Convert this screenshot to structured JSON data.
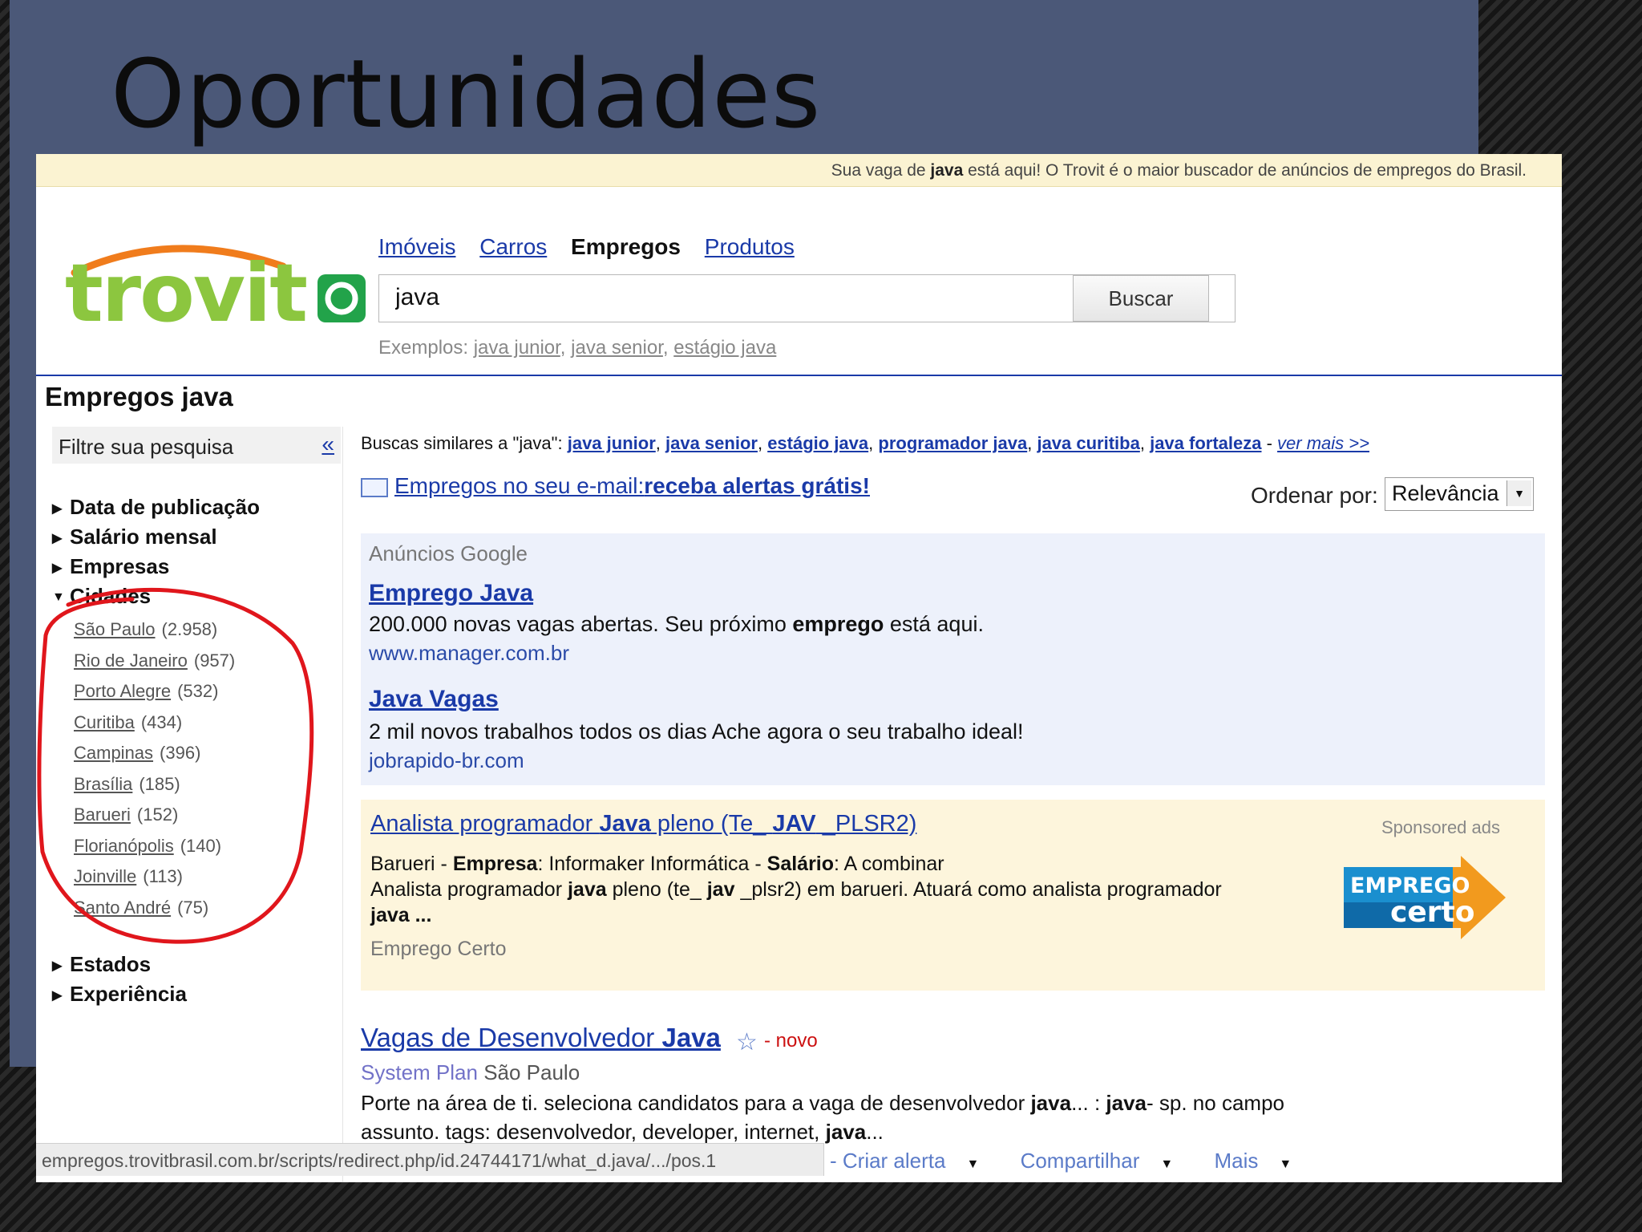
{
  "slide": {
    "title": "Oportunidades"
  },
  "promo": {
    "pre": "Sua vaga de ",
    "bold": "java",
    "post": " está aqui! O Trovit é o maior buscador de anúncios de empregos do Brasil."
  },
  "logo": {
    "text": "trovit"
  },
  "nav": [
    {
      "label": "Imóveis",
      "active": false
    },
    {
      "label": "Carros",
      "active": false
    },
    {
      "label": "Empregos",
      "active": true
    },
    {
      "label": "Produtos",
      "active": false
    }
  ],
  "search": {
    "value": "java",
    "button": "Buscar"
  },
  "examples": {
    "prefix": "Exemplos:",
    "items": [
      "java junior",
      "java senior",
      "estágio java"
    ]
  },
  "page_title": "Empregos java",
  "sidebar": {
    "filter_label": "Filtre sua pesquisa",
    "collapse_label": "«",
    "facets": [
      "Data de publicação",
      "Salário mensal",
      "Empresas",
      "Cidades",
      "Estados",
      "Experiência"
    ],
    "cities": [
      {
        "name": "São Paulo",
        "count": "(2.958)"
      },
      {
        "name": "Rio de Janeiro",
        "count": "(957)"
      },
      {
        "name": "Porto Alegre",
        "count": "(532)"
      },
      {
        "name": "Curitiba",
        "count": "(434)"
      },
      {
        "name": "Campinas",
        "count": "(396)"
      },
      {
        "name": "Brasília",
        "count": "(185)"
      },
      {
        "name": "Barueri",
        "count": "(152)"
      },
      {
        "name": "Florianópolis",
        "count": "(140)"
      },
      {
        "name": "Joinville",
        "count": "(113)"
      },
      {
        "name": "Santo André",
        "count": "(75)"
      }
    ]
  },
  "similar": {
    "prefix": "Buscas similares a \"java\":",
    "items": [
      "java junior",
      "java senior",
      "estágio java",
      "programador java",
      "java curitiba",
      "java fortaleza"
    ],
    "more": "ver mais >>"
  },
  "email_alert": {
    "text": "Empregos no seu e-mail:",
    "bold": "receba alertas grátis!"
  },
  "order": {
    "label": "Ordenar por:",
    "value": "Relevância"
  },
  "google_ads": {
    "label": "Anúncios Google",
    "ads": [
      {
        "title": "Emprego Java",
        "desc_pre": "200.000 novas vagas abertas. Seu próximo ",
        "desc_bold": "emprego",
        "desc_post": " está aqui.",
        "url": "www.manager.com.br"
      },
      {
        "title": "Java Vagas",
        "desc_pre": "2 mil novos trabalhos todos os dias Ache agora o seu trabalho ideal!",
        "desc_bold": "",
        "desc_post": "",
        "url": "jobrapido-br.com"
      }
    ]
  },
  "sponsored": {
    "title_pre": "Analista programador ",
    "title_bold1": "Java",
    "title_mid": " pleno (Te_ ",
    "title_bold2": "JAV",
    "title_post": " _PLSR2)",
    "line1_a": "Barueri - ",
    "line1_b": "Empresa",
    "line1_c": ": Informaker Informática - ",
    "line1_d": "Salário",
    "line1_e": ": A combinar",
    "line2_a": "Analista programador ",
    "line2_b": "java",
    "line2_c": " pleno (te_ ",
    "line2_d": "jav",
    "line2_e": " _plsr2) em barueri. Atuará como analista programador",
    "line3": "java ...",
    "source": "Emprego Certo",
    "label": "Sponsored ads",
    "logo_top": "EMPREGO",
    "logo_bottom": "certo"
  },
  "result": {
    "title_pre": "Vagas de Desenvolvedor ",
    "title_bold": "Java",
    "new_label": "- novo",
    "company": "System Plan",
    "location": "São Paulo",
    "desc1_a": "Porte na área de ti. seleciona candidatos para a vaga de desenvolvedor ",
    "desc1_b": "java",
    "desc1_c": "... : ",
    "desc1_d": "java",
    "desc1_e": "- sp. no campo",
    "desc2_a": "assunto. tags: desenvolvedor, developer, internet, ",
    "desc2_b": "java",
    "desc2_c": "...",
    "actions": [
      "- Criar alerta",
      "Compartilhar",
      "Mais"
    ]
  },
  "status_bar": {
    "url": "empregos.trovitbrasil.com.br/scripts/redirect.php/id.24744171/what_d.java/.../pos.1"
  },
  "colors": {
    "link": "#1a3aa8",
    "slide_bg": "#4b5878",
    "promo_bg": "#fbf3d2",
    "ads_bg": "#edf1fb",
    "sponsored_bg": "#fdf5dc",
    "annotation": "#e0161c"
  }
}
